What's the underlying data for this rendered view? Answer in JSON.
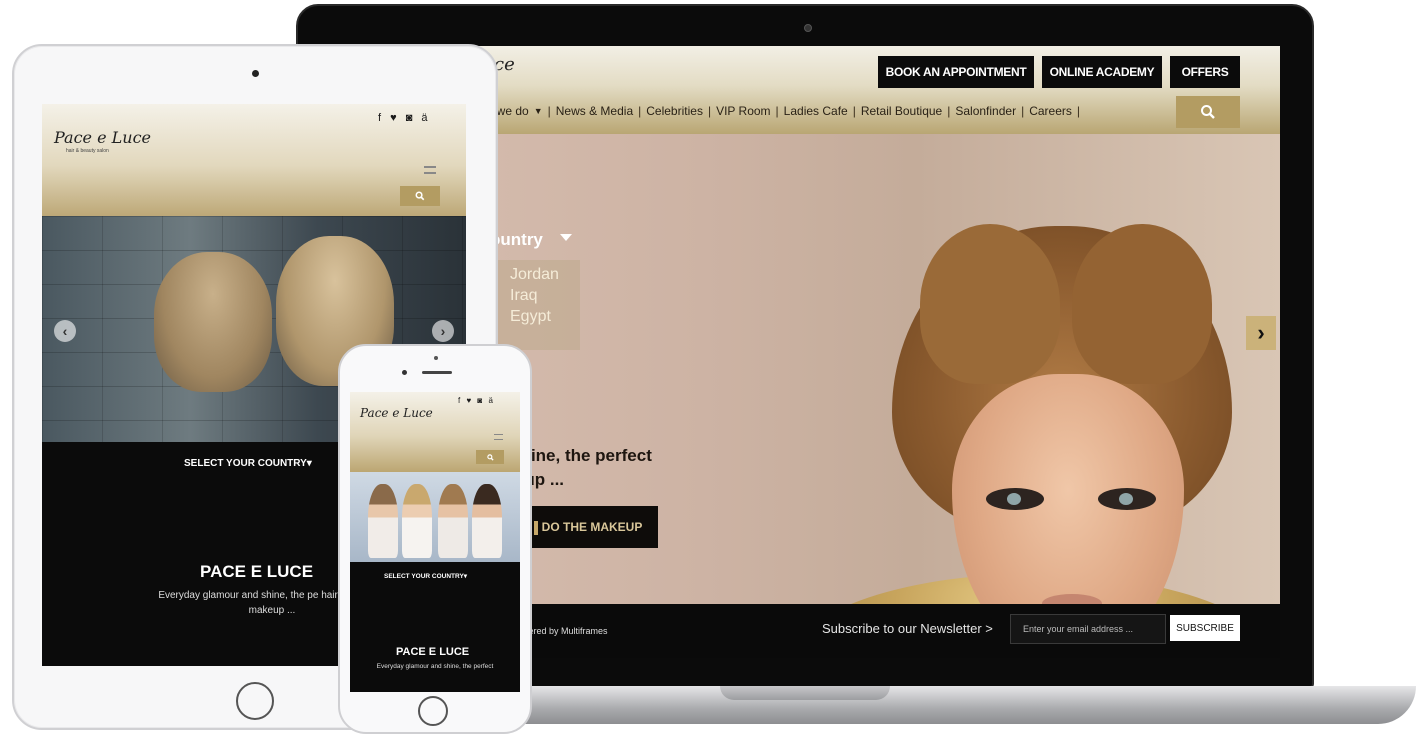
{
  "laptop": {
    "logo_fragment": "ce",
    "top_buttons": {
      "book": "BOOK AN APPOINTMENT",
      "academy": "ONLINE ACADEMY",
      "offers": "OFFERS"
    },
    "nav": {
      "what_we_do": "t we do",
      "news": "News & Media",
      "celebrities": "Celebrities",
      "vip": "VIP Room",
      "ladies": "Ladies Cafe",
      "retail": "Retail Boutique",
      "salonfinder": "Salonfinder",
      "careers": "Careers"
    },
    "country_label": "ountry",
    "countries": [
      "Jordan",
      "Iraq",
      "Egypt"
    ],
    "hero_text_line1": "d shine, the perfect",
    "hero_text_line2": "akeup ...",
    "hero_button": "DO THE MAKEUP",
    "footer": {
      "copyright_fragment": "ed. Powered by Multiframes",
      "newsletter": "Subscribe to our Newsletter >",
      "email_placeholder": "Enter your email address ...",
      "subscribe": "SUBSCRIBE"
    },
    "colors": {
      "gold": "#b39c62",
      "black": "#0b0b0b"
    }
  },
  "tablet": {
    "logo": "Pace e Luce",
    "tagline": "hair & beauty salon",
    "social": "f ♥ ◙ ä",
    "select_country": "SELECT YOUR COUNTRY▾",
    "brand": "PACE E LUCE",
    "description": "Everyday glamour and shine, the pe hair along with makeup ..."
  },
  "phone": {
    "logo": "Pace e Luce",
    "social": "f ♥ ◙ ä",
    "select_country": "SELECT YOUR COUNTRY▾",
    "brand": "PACE E LUCE",
    "description": "Everyday glamour and shine, the perfect"
  }
}
